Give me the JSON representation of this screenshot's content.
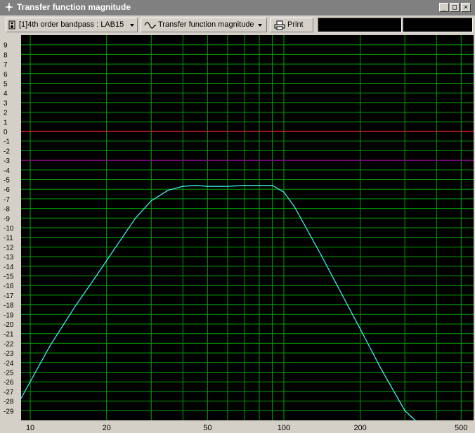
{
  "window": {
    "title": "Transfer function magnitude",
    "buttons": [
      "_",
      "□",
      "×"
    ]
  },
  "toolbar": {
    "project_selector": "[1]4th order bandpass : LAB15",
    "view_selector": "Transfer function magnitude",
    "print_label": "Print",
    "icons": [
      "speaker-icon",
      "sine-wave-icon",
      "printer-icon"
    ]
  },
  "colors": {
    "plot_background": "#000000",
    "grid": "#00a000",
    "zero_line": "#ff2020",
    "minus3_line": "#a000a0",
    "curve": "#40ffff",
    "axis_text": "#000000"
  },
  "chart_data": {
    "type": "line",
    "title": "Transfer function magnitude",
    "xlabel": "",
    "ylabel": "",
    "x_scale": "log",
    "xlim": [
      9.2,
      560
    ],
    "ylim": [
      -30,
      10
    ],
    "x_ticks": [
      10,
      20,
      50,
      100,
      200,
      500
    ],
    "y_ticks": [
      9,
      8,
      7,
      6,
      5,
      4,
      3,
      2,
      1,
      0,
      -1,
      -2,
      -3,
      -4,
      -5,
      -6,
      -7,
      -8,
      -9,
      -10,
      -11,
      -12,
      -13,
      -14,
      -15,
      -16,
      -17,
      -18,
      -19,
      -20,
      -21,
      -22,
      -23,
      -24,
      -25,
      -26,
      -27,
      -28,
      -29
    ],
    "grid": true,
    "reference_lines": [
      {
        "y": 0,
        "color": "#ff2020"
      },
      {
        "y": -3,
        "color": "#a000a0"
      }
    ],
    "series": [
      {
        "color": "#40ffff",
        "x": [
          9.2,
          12,
          15,
          18,
          22,
          26,
          30,
          35,
          40,
          45,
          50,
          60,
          70,
          80,
          90,
          100,
          110,
          120,
          140,
          170,
          200,
          240,
          300,
          330
        ],
        "y": [
          -27.7,
          -22.2,
          -18.2,
          -15.2,
          -11.8,
          -9.0,
          -7.2,
          -6.1,
          -5.7,
          -5.6,
          -5.7,
          -5.7,
          -5.6,
          -5.6,
          -5.6,
          -6.3,
          -7.8,
          -9.6,
          -12.8,
          -17.0,
          -20.5,
          -24.5,
          -29.0,
          -30.0
        ]
      }
    ]
  }
}
